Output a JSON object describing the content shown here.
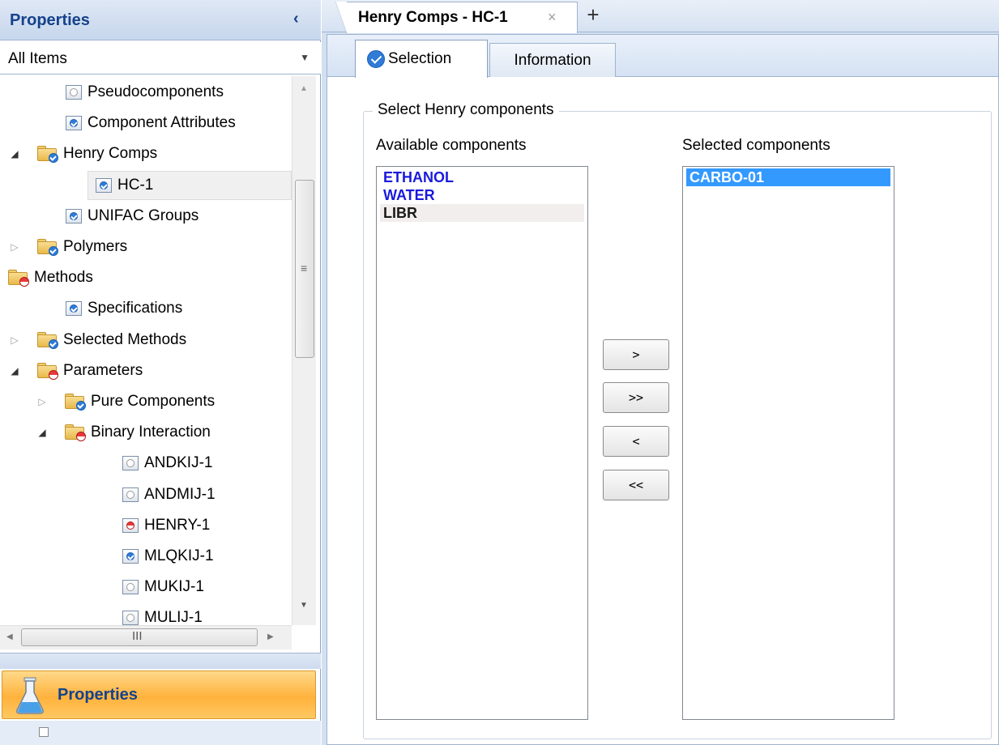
{
  "left_panel": {
    "header_title": "Properties",
    "collapse_glyph": "‹",
    "filter_value": "All Items",
    "tree": [
      {
        "label": "Pseudocomponents",
        "icon": "form-empty-icon"
      },
      {
        "label": "Component Attributes",
        "icon": "form-check-icon"
      },
      {
        "label": "Henry Comps",
        "icon": "folder-check-icon",
        "expanded": true
      },
      {
        "label": "HC-1",
        "icon": "form-check-icon",
        "selected": true
      },
      {
        "label": "UNIFAC Groups",
        "icon": "form-check-icon"
      },
      {
        "label": "Polymers",
        "icon": "folder-check-icon",
        "expanded": false
      },
      {
        "label": "Methods",
        "icon": "folder-red-icon",
        "expanded": true
      },
      {
        "label": "Specifications",
        "icon": "form-check-icon"
      },
      {
        "label": "Selected Methods",
        "icon": "folder-check-icon",
        "expanded": false
      },
      {
        "label": "Parameters",
        "icon": "folder-red-icon",
        "expanded": true
      },
      {
        "label": "Pure Components",
        "icon": "folder-check-icon",
        "expanded": false
      },
      {
        "label": "Binary Interaction",
        "icon": "folder-red-icon",
        "expanded": true
      },
      {
        "label": "ANDKIJ-1",
        "icon": "form-empty-icon"
      },
      {
        "label": "ANDMIJ-1",
        "icon": "form-empty-icon"
      },
      {
        "label": "HENRY-1",
        "icon": "form-red-icon"
      },
      {
        "label": "MLQKIJ-1",
        "icon": "form-check-icon"
      },
      {
        "label": "MUKIJ-1",
        "icon": "form-empty-icon"
      },
      {
        "label": "MULIJ-1",
        "icon": "form-empty-icon"
      }
    ],
    "hscroll_grip": "III",
    "vscroll_grip": "≡",
    "nav_button_label": "Properties"
  },
  "document": {
    "tab_title": "Henry Comps - HC-1",
    "tab_close": "×",
    "new_tab": "+",
    "tabs": [
      {
        "label": "Selection",
        "active": true
      },
      {
        "label": "Information",
        "active": false
      }
    ],
    "group_title": "Select Henry components",
    "available_label": "Available components",
    "selected_label": "Selected components",
    "available_items": [
      "ETHANOL",
      "WATER",
      "LIBR"
    ],
    "selected_items": [
      "CARBO-01"
    ],
    "buttons": {
      "add": ">",
      "add_all": ">>",
      "remove": "<",
      "remove_all": "<<"
    }
  },
  "colors": {
    "accent_blue": "#1a1adc",
    "selection": "#3399ff",
    "nav_orange": "#ffb23c",
    "header_text": "#15428b"
  }
}
